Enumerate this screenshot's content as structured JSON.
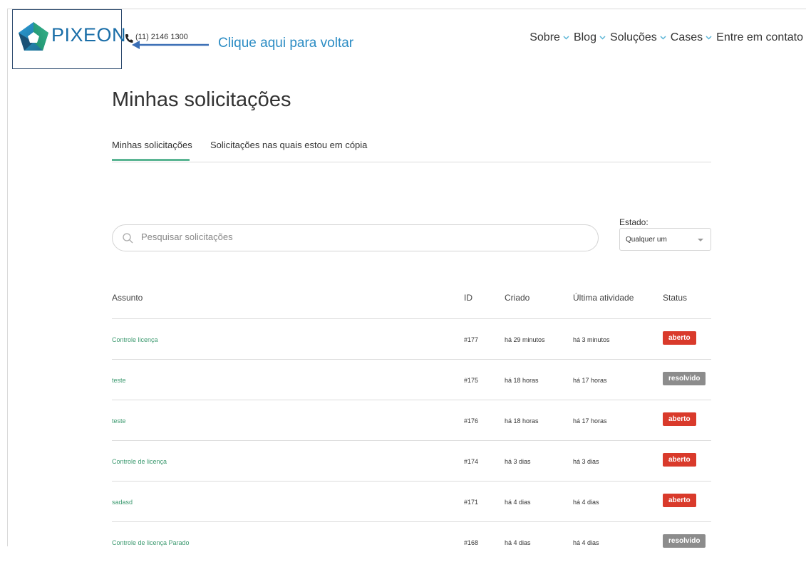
{
  "header": {
    "logo_text": "PIXEON",
    "phone": "(11) 2146 1300",
    "annotation": "Clique aqui para voltar",
    "nav": [
      {
        "label": "Sobre",
        "has_dropdown": true
      },
      {
        "label": "Blog",
        "has_dropdown": true
      },
      {
        "label": "Soluções",
        "has_dropdown": true
      },
      {
        "label": "Cases",
        "has_dropdown": true
      },
      {
        "label": "Entre em contato",
        "has_dropdown": false
      }
    ]
  },
  "page": {
    "title": "Minhas solicitações",
    "tabs": [
      {
        "label": "Minhas solicitações",
        "active": true
      },
      {
        "label": "Solicitações nas quais estou em cópia",
        "active": false
      }
    ]
  },
  "search": {
    "placeholder": "Pesquisar solicitações",
    "value": ""
  },
  "filter": {
    "label": "Estado:",
    "selected": "Qualquer um"
  },
  "table": {
    "columns": [
      "Assunto",
      "ID",
      "Criado",
      "Última atividade",
      "Status"
    ],
    "rows": [
      {
        "subject": "Controle licença",
        "id": "#177",
        "created": "há 29 minutos",
        "last_activity": "há 3 minutos",
        "status": "aberto"
      },
      {
        "subject": "teste",
        "id": "#175",
        "created": "há 18 horas",
        "last_activity": "há 17 horas",
        "status": "resolvido"
      },
      {
        "subject": "teste",
        "id": "#176",
        "created": "há 18 horas",
        "last_activity": "há 17 horas",
        "status": "aberto"
      },
      {
        "subject": "Controle de licença",
        "id": "#174",
        "created": "há 3 dias",
        "last_activity": "há 3 dias",
        "status": "aberto"
      },
      {
        "subject": "sadasd",
        "id": "#171",
        "created": "há 4 dias",
        "last_activity": "há 4 dias",
        "status": "aberto"
      },
      {
        "subject": "Controle de licença Parado",
        "id": "#168",
        "created": "há 4 dias",
        "last_activity": "há 4 dias",
        "status": "resolvido"
      }
    ]
  },
  "colors": {
    "brand": "#1a6ea8",
    "accent_green": "#5ab593",
    "link_green": "#3d9a70",
    "status_open": "#d93a2b",
    "status_solved": "#8c8c8c",
    "annotation": "#2b8cc4"
  },
  "icons": [
    "pixeon-logo-icon",
    "phone-icon",
    "arrow-left-icon",
    "chevron-down-icon",
    "search-icon",
    "caret-down-icon"
  ]
}
